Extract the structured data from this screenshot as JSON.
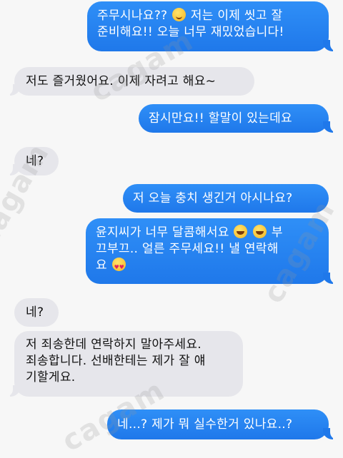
{
  "messages": [
    {
      "side": "out",
      "text": "주무시나요?? ",
      "emoji": "smile",
      "text2": " 저는 이제 씻고 잘\n준비해요!! 오늘 너무 재밌었습니다!"
    },
    {
      "side": "in",
      "text": "저도 즐거웠어요. 이제 자려고 해요~"
    },
    {
      "side": "out",
      "text": "잠시만요!! 할말이 있는데요"
    },
    {
      "side": "in",
      "text": "네?"
    },
    {
      "side": "out",
      "text": "저 오늘 충치 생긴거 아시나요?"
    },
    {
      "side": "out",
      "text": "윤지씨가 너무 달콤해서요 ",
      "emoji": "laugh",
      "text2": "부\n끄부끄.. 얼른 주무세요!! 낼 연락해\n요 "
    },
    {
      "side": "in",
      "text": "네?"
    },
    {
      "side": "in",
      "text": "저 죄송한데 연락하지 말아주세요.\n죄송합니다. 선배한테는 제가 잘 얘\n기할게요."
    },
    {
      "side": "out",
      "text": "네...? 제가 뭐 실수한거 있나요..?"
    }
  ],
  "watermark": "cagam"
}
